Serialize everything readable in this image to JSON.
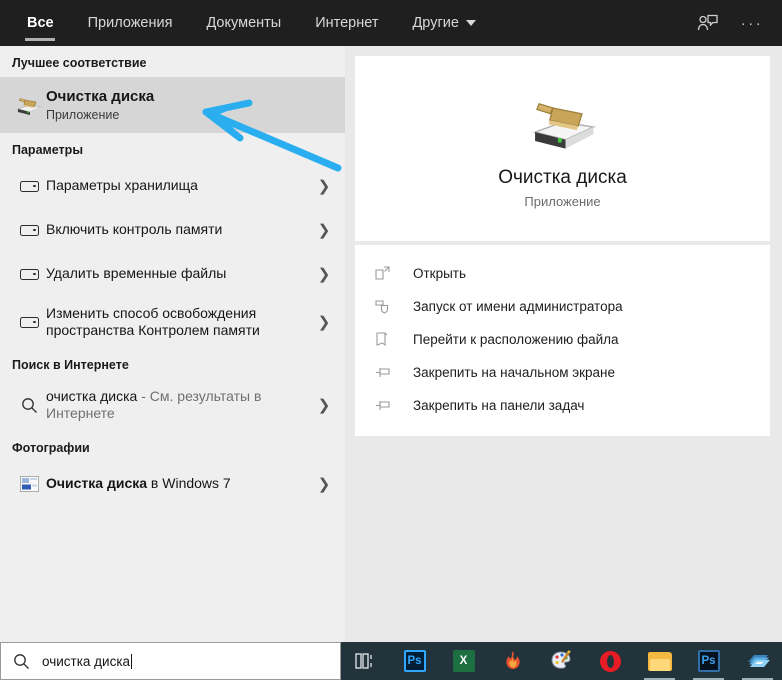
{
  "header": {
    "tabs": [
      {
        "label": "Все",
        "active": true
      },
      {
        "label": "Приложения",
        "active": false
      },
      {
        "label": "Документы",
        "active": false
      },
      {
        "label": "Интернет",
        "active": false
      },
      {
        "label": "Другие",
        "active": false,
        "has_caret": true
      }
    ],
    "feedback_icon": "feedback-person-icon",
    "more_label": "···"
  },
  "left": {
    "best_match_title": "Лучшее соответствие",
    "best_match": {
      "title": "Очистка диска",
      "subtitle": "Приложение",
      "icon": "disk-cleanup-icon"
    },
    "settings_title": "Параметры",
    "settings_items": [
      {
        "label": "Параметры хранилища",
        "icon": "drive-icon"
      },
      {
        "label": "Включить контроль памяти",
        "icon": "drive-icon"
      },
      {
        "label": "Удалить временные файлы",
        "icon": "drive-icon"
      },
      {
        "label": "Изменить способ освобождения пространства Контролем памяти",
        "icon": "drive-icon"
      }
    ],
    "web_title": "Поиск в Интернете",
    "web_item": {
      "query": "очистка диска",
      "suffix": " - См. результаты в Интернете",
      "icon": "search-icon"
    },
    "photos_title": "Фотографии",
    "photos_item": {
      "strong": "Очистка диска",
      "rest": " в Windows 7",
      "icon": "photo-thumbnail-icon"
    }
  },
  "preview": {
    "app_name": "Очистка диска",
    "app_kind": "Приложение",
    "app_icon": "disk-cleanup-icon",
    "actions": [
      {
        "label": "Открыть",
        "icon": "open-external-icon"
      },
      {
        "label": "Запуск от имени администратора",
        "icon": "shield-icon"
      },
      {
        "label": "Перейти к расположению файла",
        "icon": "folder-icon"
      },
      {
        "label": "Закрепить на начальном экране",
        "icon": "pin-icon"
      },
      {
        "label": "Закрепить на панели задач",
        "icon": "pin-icon"
      }
    ]
  },
  "annotation": {
    "shape": "hand-drawn-arrow-left",
    "color": "#2BAEF0"
  },
  "search": {
    "value": "очистка диска",
    "icon": "search-icon"
  },
  "taskbar": {
    "items": [
      {
        "name": "task-view-icon",
        "label": ""
      },
      {
        "name": "photoshop-icon",
        "label": "Ps"
      },
      {
        "name": "excel-icon",
        "label": "X"
      },
      {
        "name": "flame-app-icon",
        "label": ""
      },
      {
        "name": "paint-icon",
        "label": ""
      },
      {
        "name": "opera-icon",
        "label": ""
      },
      {
        "name": "file-explorer-icon",
        "label": ""
      },
      {
        "name": "photoshop-dark-icon",
        "label": "Ps"
      },
      {
        "name": "windows-layers-icon",
        "label": ""
      }
    ]
  },
  "colors": {
    "header_bg": "#1F1F1F",
    "left_bg": "#EFEFEF",
    "selected_row": "#D6D6D6",
    "taskbar_bg": "#22333C",
    "annotation": "#2BAEF0"
  }
}
